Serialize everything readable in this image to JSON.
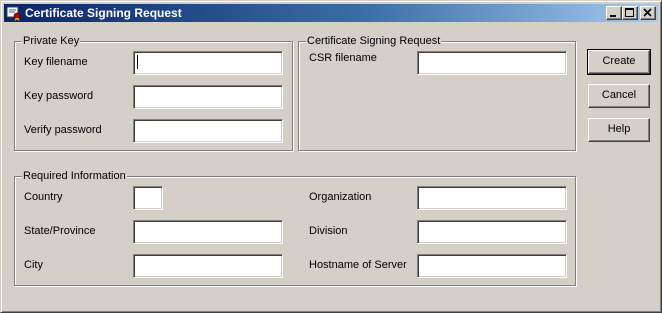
{
  "window": {
    "title": "Certificate Signing Request",
    "icon": "certificate-app-icon",
    "controls": [
      "minimize-icon",
      "maximize-icon",
      "close-icon"
    ]
  },
  "private_key": {
    "group_title": "Private Key",
    "key_filename_label": "Key filename",
    "key_filename_value": "",
    "key_password_label": "Key password",
    "key_password_value": "",
    "verify_password_label": "Verify password",
    "verify_password_value": ""
  },
  "csr": {
    "group_title": "Certificate Signing Request",
    "csr_filename_label": "CSR filename",
    "csr_filename_value": ""
  },
  "required": {
    "group_title": "Required Information",
    "country_label": "Country",
    "state_label": "State/Province",
    "city_label": "City",
    "organization_label": "Organization",
    "division_label": "Division",
    "hostname_label": "Hostname of Server"
  },
  "buttons": {
    "create": "Create",
    "cancel": "Cancel",
    "help": "Help"
  }
}
